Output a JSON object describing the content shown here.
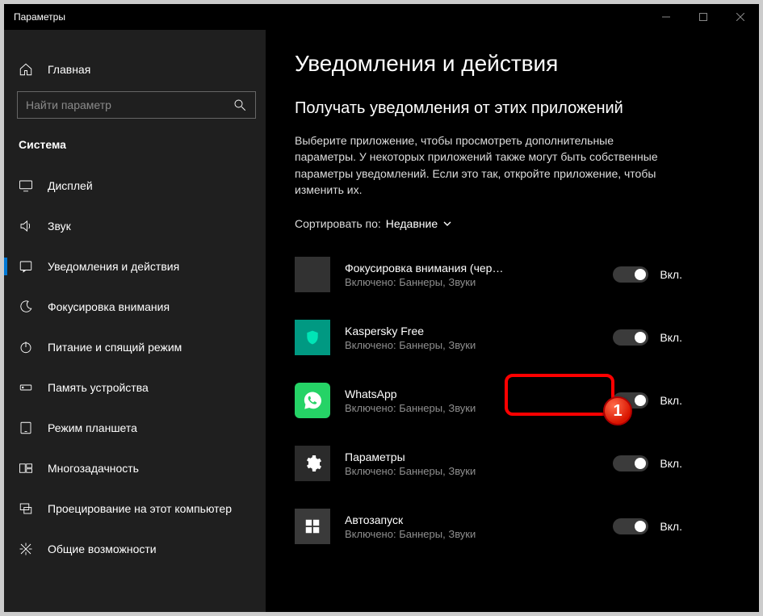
{
  "window": {
    "title": "Параметры"
  },
  "sidebar": {
    "home": "Главная",
    "search_placeholder": "Найти параметр",
    "section": "Система",
    "items": [
      {
        "label": "Дисплей"
      },
      {
        "label": "Звук"
      },
      {
        "label": "Уведомления и действия"
      },
      {
        "label": "Фокусировка внимания"
      },
      {
        "label": "Питание и спящий режим"
      },
      {
        "label": "Память устройства"
      },
      {
        "label": "Режим планшета"
      },
      {
        "label": "Многозадачность"
      },
      {
        "label": "Проецирование на этот компьютер"
      },
      {
        "label": "Общие возможности"
      }
    ]
  },
  "main": {
    "heading": "Уведомления и действия",
    "subheading": "Получать уведомления от этих приложений",
    "description": "Выберите приложение, чтобы просмотреть дополнительные параметры. У некоторых приложений также могут быть собственные параметры уведомлений. Если это так, откройте приложение, чтобы изменить их.",
    "sort_label": "Сортировать по:",
    "sort_value": "Недавние",
    "toggle_on_label": "Вкл.",
    "apps": [
      {
        "name": "Фокусировка внимания (через...",
        "sub": "Включено: Баннеры, Звуки"
      },
      {
        "name": "Kaspersky Free",
        "sub": "Включено: Баннеры, Звуки"
      },
      {
        "name": "WhatsApp",
        "sub": "Включено: Баннеры, Звуки"
      },
      {
        "name": "Параметры",
        "sub": "Включено: Баннеры, Звуки"
      },
      {
        "name": "Автозапуск",
        "sub": "Включено: Баннеры, Звуки"
      }
    ]
  },
  "annotation": {
    "badge": "1"
  }
}
